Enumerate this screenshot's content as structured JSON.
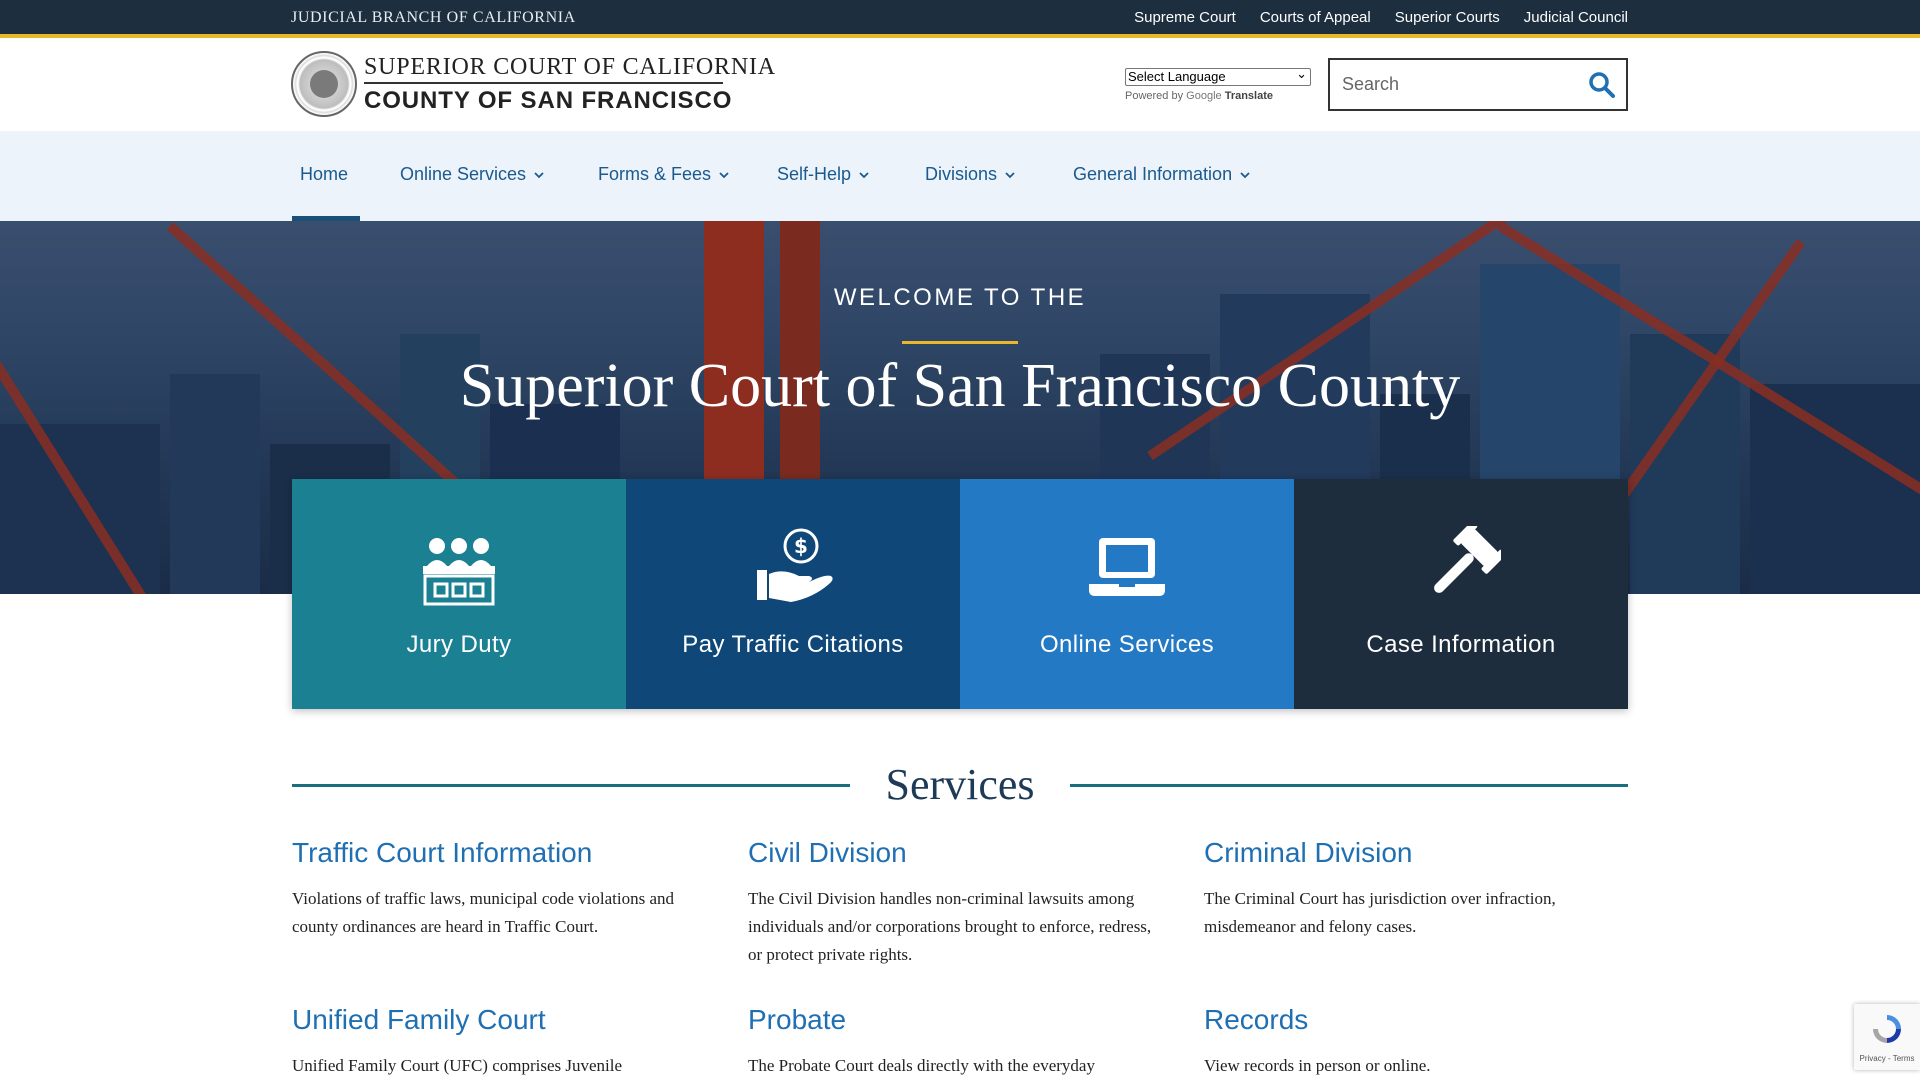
{
  "topbar": {
    "brand": "JUDICIAL BRANCH OF CALIFORNIA",
    "links": [
      "Supreme Court",
      "Courts of Appeal",
      "Superior Courts",
      "Judicial Council"
    ]
  },
  "header": {
    "logo_line1": "SUPERIOR COURT OF CALIFORNIA",
    "logo_line2": "COUNTY OF SAN FRANCISCO",
    "language_select": "Select Language",
    "powered_by": "Powered by",
    "google": "Google",
    "translate": "Translate",
    "search_placeholder": "Search"
  },
  "nav": {
    "items": [
      {
        "label": "Home"
      },
      {
        "label": "Online Services"
      },
      {
        "label": "Forms & Fees"
      },
      {
        "label": "Self-Help"
      },
      {
        "label": "Divisions"
      },
      {
        "label": "General Information"
      }
    ],
    "active": "Home"
  },
  "hero": {
    "welcome": "WELCOME TO THE",
    "title": "Superior Court of San Francisco County"
  },
  "tiles": [
    {
      "label": "Jury Duty",
      "color": "#1a8092",
      "icon": "jury-icon"
    },
    {
      "label": "Pay Traffic Citations",
      "color": "#0f4778",
      "icon": "hand-dollar-icon"
    },
    {
      "label": "Online Services",
      "color": "#2479c4",
      "icon": "laptop-icon"
    },
    {
      "label": "Case Information",
      "color": "#1e2d3d",
      "icon": "gavel-icon"
    }
  ],
  "services": {
    "heading": "Services",
    "items": [
      {
        "title": "Traffic Court Information",
        "desc": "Violations of traffic laws, municipal code violations and county ordinances are heard in Traffic Court."
      },
      {
        "title": "Civil Division",
        "desc": "The Civil Division handles non-criminal lawsuits among individuals and/or corporations brought to enforce, redress, or protect private rights."
      },
      {
        "title": "Criminal Division",
        "desc": "The Criminal Court has jurisdiction over infraction, misdemeanor and felony cases."
      },
      {
        "title": "Unified Family Court",
        "desc": "Unified Family Court (UFC) comprises Juvenile"
      },
      {
        "title": "Probate",
        "desc": "The Probate Court deals directly with the everyday"
      },
      {
        "title": "Records",
        "desc": "View records in person or online."
      }
    ]
  },
  "recaptcha": {
    "text": "Privacy - Terms"
  },
  "colors": {
    "accent_gold": "#e8b82a",
    "nav_text": "#1a5a8f",
    "link_blue": "#1f6fb3",
    "topbar": "#1d2e3e"
  }
}
